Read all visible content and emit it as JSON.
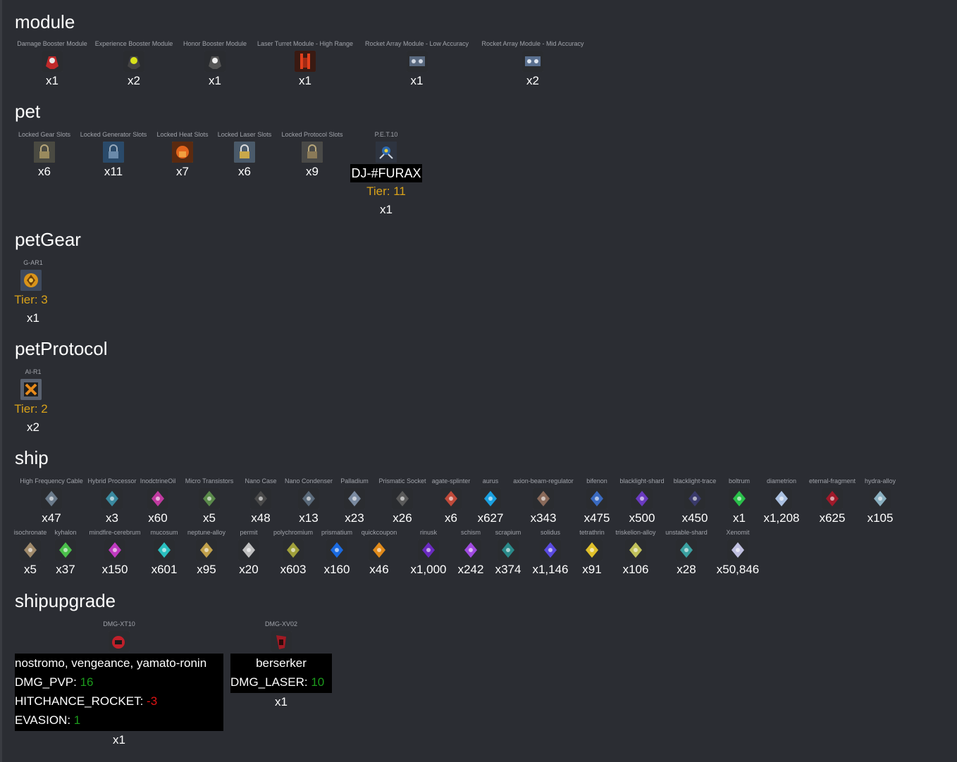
{
  "sections": {
    "module": {
      "title": "module",
      "items": [
        {
          "name": "Damage Booster Module",
          "qty": "x1",
          "icon": "damage-booster-module-icon"
        },
        {
          "name": "Experience Booster Module",
          "qty": "x2",
          "icon": "experience-booster-module-icon"
        },
        {
          "name": "Honor Booster Module",
          "qty": "x1",
          "icon": "honor-booster-module-icon"
        },
        {
          "name": "Laser Turret Module - High Range",
          "qty": "x1",
          "icon": "laser-turret-module-icon"
        },
        {
          "name": "Rocket Array Module - Low Accuracy",
          "qty": "x1",
          "icon": "rocket-array-module-icon"
        },
        {
          "name": "Rocket Array Module - Mid Accuracy",
          "qty": "x2",
          "icon": "rocket-array-module-icon"
        }
      ]
    },
    "pet": {
      "title": "pet",
      "items": [
        {
          "name": "Locked Gear Slots",
          "qty": "x6",
          "icon": "lock-icon"
        },
        {
          "name": "Locked Generator Slots",
          "qty": "x11",
          "icon": "lock-icon"
        },
        {
          "name": "Locked Heat Slots",
          "qty": "x7",
          "icon": "lock-icon"
        },
        {
          "name": "Locked Laser Slots",
          "qty": "x6",
          "icon": "lock-icon"
        },
        {
          "name": "Locked Protocol Slots",
          "qty": "x9",
          "icon": "lock-icon"
        }
      ],
      "pet_unit": {
        "name": "P.E.T.10",
        "label": "DJ-#FURAX",
        "tier": "Tier: 11",
        "qty": "x1"
      }
    },
    "petGear": {
      "title": "petGear",
      "item": {
        "name": "G-AR1",
        "tier": "Tier: 3",
        "qty": "x1"
      }
    },
    "petProtocol": {
      "title": "petProtocol",
      "item": {
        "name": "AI-R1",
        "tier": "Tier: 2",
        "qty": "x2"
      }
    },
    "ship": {
      "title": "ship",
      "row1": [
        {
          "name": "High Frequency Cable",
          "qty": "x47"
        },
        {
          "name": "Hybrid Processor",
          "qty": "x3"
        },
        {
          "name": "InodctrineOil",
          "qty": "x60"
        },
        {
          "name": "Micro Transistors",
          "qty": "x5"
        },
        {
          "name": "Nano Case",
          "qty": "x48"
        },
        {
          "name": "Nano Condenser",
          "qty": "x13"
        },
        {
          "name": "Palladium",
          "qty": "x23"
        },
        {
          "name": "Prismatic Socket",
          "qty": "x26"
        },
        {
          "name": "agate-splinter",
          "qty": "x6"
        },
        {
          "name": "aurus",
          "qty": "x627"
        },
        {
          "name": "axion-beam-regulator",
          "qty": "x343"
        },
        {
          "name": "bifenon",
          "qty": "x475"
        },
        {
          "name": "blacklight-shard",
          "qty": "x500"
        },
        {
          "name": "blacklight-trace",
          "qty": "x450"
        },
        {
          "name": "boltrum",
          "qty": "x1"
        },
        {
          "name": "diametrion",
          "qty": "x1,208"
        },
        {
          "name": "eternal-fragment",
          "qty": "x625"
        },
        {
          "name": "hydra-alloy",
          "qty": "x105"
        }
      ],
      "row2": [
        {
          "name": "isochronate",
          "qty": "x5"
        },
        {
          "name": "kyhalon",
          "qty": "x37"
        },
        {
          "name": "mindfire-cerebrum",
          "qty": "x150"
        },
        {
          "name": "mucosum",
          "qty": "x601"
        },
        {
          "name": "neptune-alloy",
          "qty": "x95"
        },
        {
          "name": "permit",
          "qty": "x20"
        },
        {
          "name": "polychromium",
          "qty": "x603"
        },
        {
          "name": "prismatium",
          "qty": "x160"
        },
        {
          "name": "quickcoupon",
          "qty": "x46"
        },
        {
          "name": "rinusk",
          "qty": "x1,000"
        },
        {
          "name": "schism",
          "qty": "x242"
        },
        {
          "name": "scrapium",
          "qty": "x374"
        },
        {
          "name": "solidus",
          "qty": "x1,146"
        },
        {
          "name": "tetrathrin",
          "qty": "x91"
        },
        {
          "name": "triskelion-alloy",
          "qty": "x106"
        },
        {
          "name": "unstable-shard",
          "qty": "x28"
        },
        {
          "name": "Xenomit",
          "qty": "x50,846"
        }
      ]
    },
    "shipupgrade": {
      "title": "shipupgrade",
      "items": [
        {
          "name": "DMG-XT10",
          "ships": "nostromo, vengeance, yamato-ronin",
          "stats": [
            {
              "key": "DMG_PVP: ",
              "val": "16",
              "sign": "pos"
            },
            {
              "key": "HITCHANCE_ROCKET: ",
              "val": "-3",
              "sign": "neg"
            },
            {
              "key": "EVASION: ",
              "val": "1",
              "sign": "pos"
            }
          ],
          "qty": "x1"
        },
        {
          "name": "DMG-XV02",
          "ships": "berserker",
          "stats": [
            {
              "key": "DMG_LASER: ",
              "val": "10",
              "sign": "pos"
            }
          ],
          "qty": "x1"
        }
      ]
    }
  },
  "colors": {
    "background": "#2b2d33",
    "tier": "#d9a21a",
    "positive": "#1c9a1c",
    "negative": "#e01414"
  }
}
